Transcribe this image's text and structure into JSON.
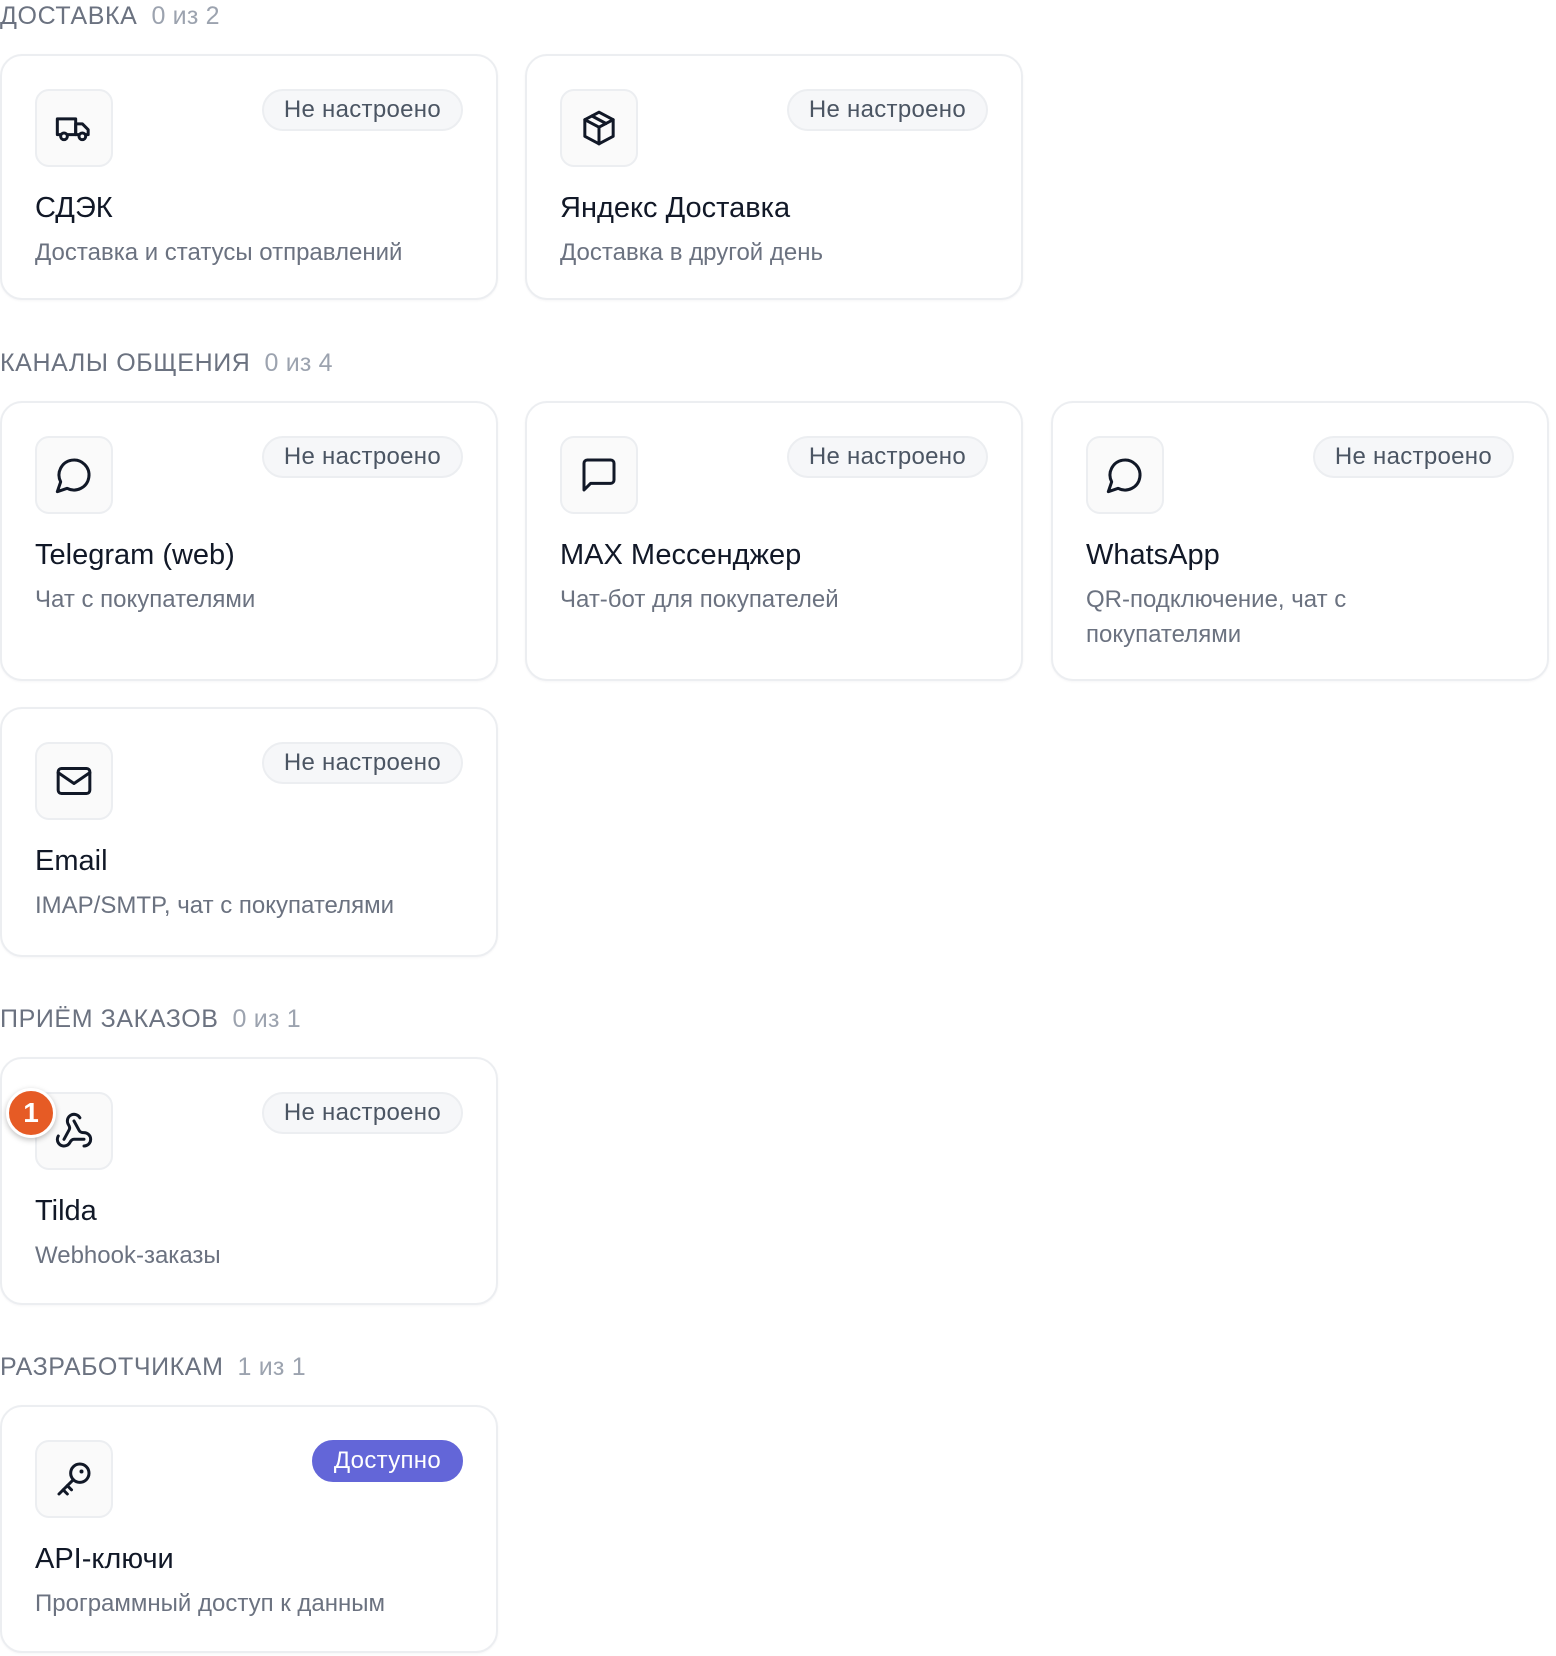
{
  "sections": [
    {
      "title": "ДОСТАВКА",
      "count": "0 из 2"
    },
    {
      "title": "КАНАЛЫ ОБЩЕНИЯ",
      "count": "0 из 4"
    },
    {
      "title": "ПРИЁМ ЗАКАЗОВ",
      "count": "0 из 1"
    },
    {
      "title": "РАЗРАБОТЧИКАМ",
      "count": "1 из 1"
    }
  ],
  "cards": {
    "cdek": {
      "icon": "truck-icon",
      "status": "Не настроено",
      "title": "СДЭК",
      "description": "Доставка и статусы отправлений"
    },
    "yandex": {
      "icon": "package-icon",
      "status": "Не настроено",
      "title": "Яндекс Доставка",
      "description": "Доставка в другой день"
    },
    "telegram": {
      "icon": "chat-bubble-icon",
      "status": "Не настроено",
      "title": "Telegram (web)",
      "description": "Чат с покупателями"
    },
    "max": {
      "icon": "message-square-icon",
      "status": "Не настроено",
      "title": "MAX Мессенджер",
      "description": "Чат-бот для покупателей"
    },
    "whatsapp": {
      "icon": "chat-bubble-icon",
      "status": "Не настроено",
      "title": "WhatsApp",
      "description": "QR-подключение, чат с покупателями"
    },
    "email": {
      "icon": "mail-icon",
      "status": "Не настроено",
      "title": "Email",
      "description": "IMAP/SMTP, чат с покупателями"
    },
    "tilda": {
      "icon": "webhook-icon",
      "status": "Не настроено",
      "title": "Tilda",
      "description": "Webhook-заказы"
    },
    "api": {
      "icon": "key-icon",
      "status": "Доступно",
      "title": "API-ключи",
      "description": "Программный доступ к данным"
    }
  },
  "notification": {
    "count": "1"
  },
  "colors": {
    "accent": "#6366d8",
    "notification": "#e65b25",
    "border": "#eceef1",
    "muted_text": "#6b7280"
  }
}
